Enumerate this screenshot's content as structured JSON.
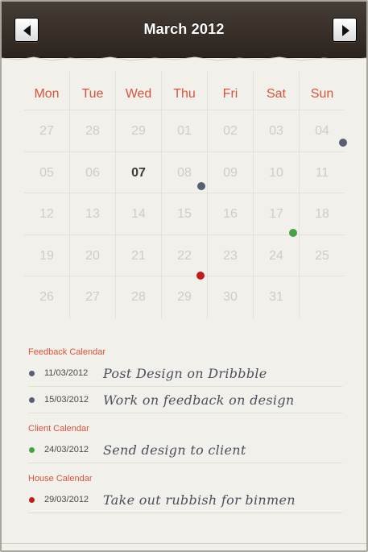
{
  "header": {
    "title": "March 2012",
    "prev_icon": "left-arrow",
    "next_icon": "right-arrow"
  },
  "days_of_week": [
    "Mon",
    "Tue",
    "Wed",
    "Thu",
    "Fri",
    "Sat",
    "Sun"
  ],
  "weeks": [
    [
      "27",
      "28",
      "29",
      "01",
      "02",
      "03",
      "04"
    ],
    [
      "05",
      "06",
      "07",
      "08",
      "09",
      "10",
      "11"
    ],
    [
      "12",
      "13",
      "14",
      "15",
      "16",
      "17",
      "18"
    ],
    [
      "19",
      "20",
      "21",
      "22",
      "23",
      "24",
      "25"
    ],
    [
      "26",
      "27",
      "28",
      "29",
      "30",
      "31",
      ""
    ]
  ],
  "today": "07",
  "calendars": [
    {
      "name": "Feedback Calendar",
      "color": "#556070",
      "events": [
        {
          "date": "11/03/2012",
          "title": "Post Design on Dribbble"
        },
        {
          "date": "15/03/2012",
          "title": "Work on feedback on design"
        }
      ]
    },
    {
      "name": "Client Calendar",
      "color": "#45a245",
      "events": [
        {
          "date": "24/03/2012",
          "title": "Send design to client"
        }
      ]
    },
    {
      "name": "House Calendar",
      "color": "#c11b1b",
      "events": [
        {
          "date": "29/03/2012",
          "title": "Take out rubbish for binmen"
        }
      ]
    }
  ],
  "colors": {
    "accent": "#d8533b",
    "header": "#3a312a"
  }
}
